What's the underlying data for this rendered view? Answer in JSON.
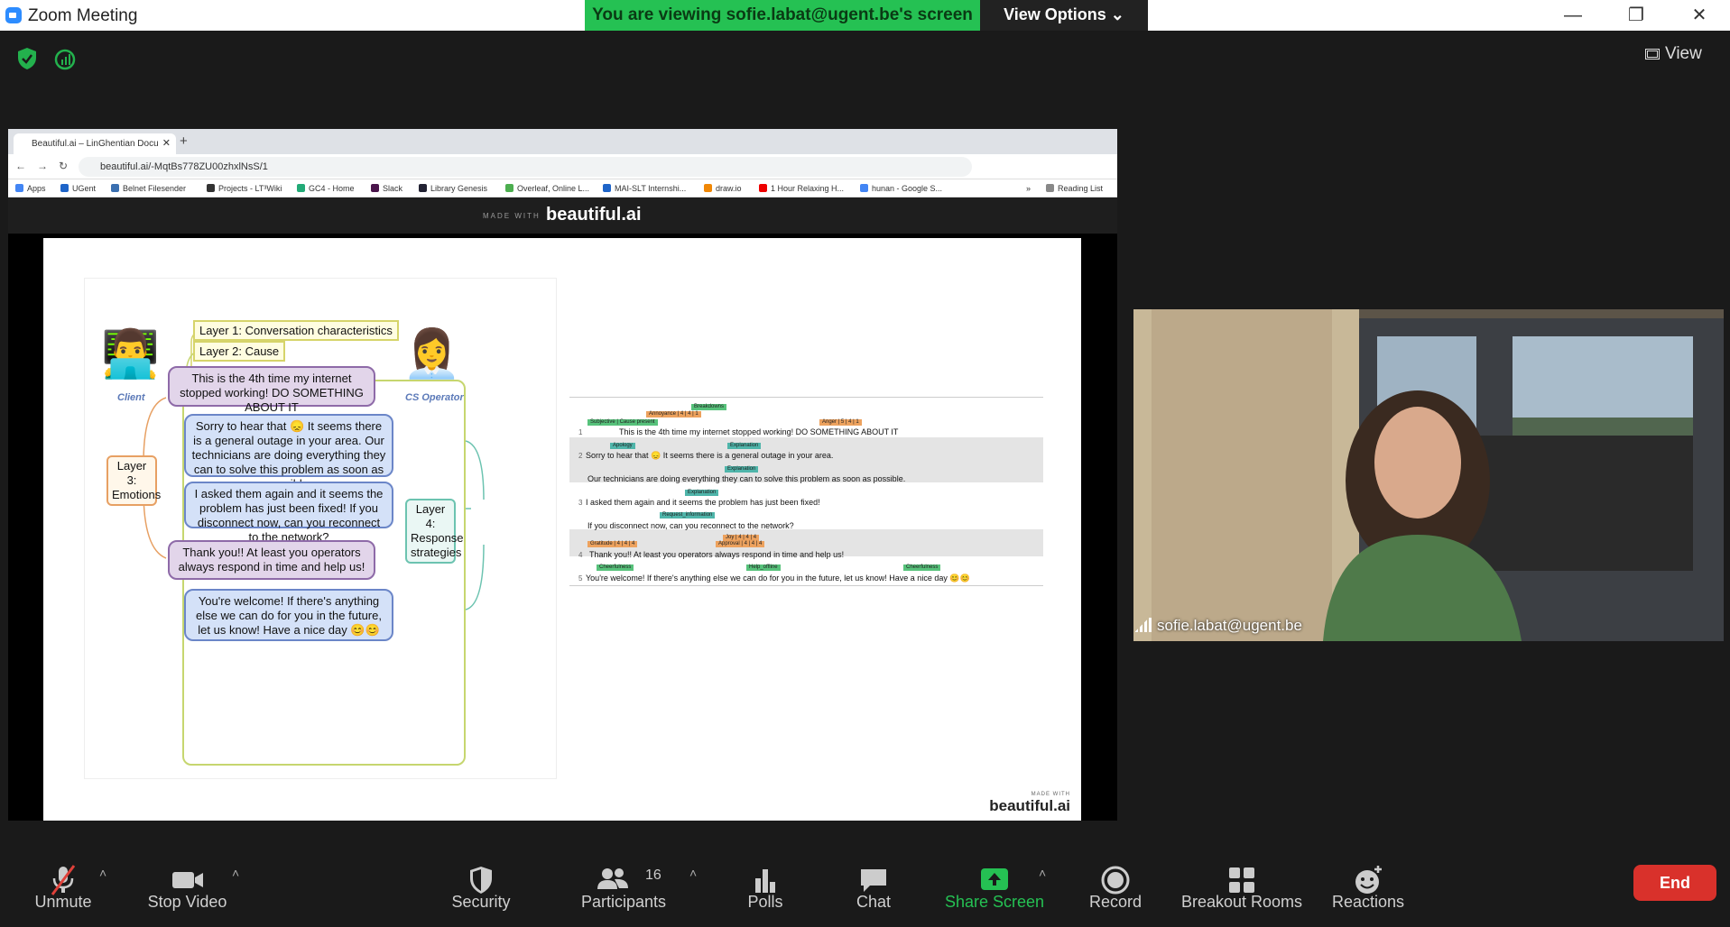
{
  "window": {
    "title": "Zoom Meeting",
    "viewing_banner": "You are viewing sofie.labat@ugent.be's screen",
    "view_options": "View Options",
    "minimize": "—",
    "restore": "❐",
    "close": "✕",
    "view_label": "View"
  },
  "browser": {
    "tab_title": "Beautiful.ai – LinGhentian Docu",
    "tab_close": "✕",
    "new_tab": "+",
    "url": "beautiful.ai/-MqtBs778ZU00zhxlNsS/1",
    "bookmarks": [
      "Apps",
      "UGent",
      "Belnet Filesender",
      "Projects - LT³Wiki",
      "GC4 - Home",
      "Slack",
      "Library Genesis",
      "Overleaf, Online L...",
      "MAI-SLT Internshi...",
      "draw.io",
      "1 Hour Relaxing H...",
      "hunan - Google S...",
      "»",
      "Reading List"
    ]
  },
  "banner": {
    "small": "MADE WITH",
    "brand": "beautiful.ai"
  },
  "figure": {
    "layer1": "Layer 1: Conversation characteristics",
    "layer2": "Layer 2: Cause",
    "layer3": [
      "Layer 3:",
      "Emotions"
    ],
    "layer4": [
      "Layer 4:",
      "Response",
      "strategies"
    ],
    "client_caption": "Client",
    "operator_caption": "CS Operator",
    "bubbles": [
      "This is the 4th time my internet stopped working! DO SOMETHING ABOUT IT",
      "Sorry to hear that 😞 It seems there is a general outage in your area. Our technicians are doing everything they can to solve this problem as soon as possible.",
      "I asked them again and it seems the problem has just been fixed! If you disconnect now, can you reconnect to the network?",
      "Thank you!! At least you operators always respond in time and help us!",
      "You're welcome! If there's anything else we can do for you in the future, let us know! Have a nice day 😊😊"
    ]
  },
  "annotation": {
    "tags": [
      "Breakdowns",
      "Annoyance | 4 | 4 | 1",
      "Subjective | Cause present",
      "Anger | 5 | 4 | 1",
      "Apology",
      "Explanation",
      "Explanation",
      "Explanation",
      "Request_information",
      "Joy | 4 | 4 | 4",
      "Gratitude | 4 | 4 | 4",
      "Approval | 4 | 4 | 4",
      "Cheerfulness",
      "Help_offline",
      "Cheerfulness"
    ],
    "lines": [
      {
        "n": "1",
        "text": "This is the 4th time my internet stopped working! DO SOMETHING ABOUT IT"
      },
      {
        "n": "2",
        "text": "Sorry to hear that 😞 It seems there is a general outage in your area."
      },
      {
        "n": "",
        "text": "Our technicians are doing everything they can to solve this problem as soon as possible."
      },
      {
        "n": "3",
        "text": "I asked them again and it seems the problem has just been fixed!"
      },
      {
        "n": "",
        "text": "If you disconnect now, can you reconnect to the network?"
      },
      {
        "n": "4",
        "text": "Thank you!!  At least you operators always respond in time and help us!"
      },
      {
        "n": "5",
        "text": "You're welcome! If there's anything else we can do for you in the future, let us know! Have a nice day 😊😊"
      }
    ]
  },
  "slide_brand": {
    "small": "MADE WITH",
    "brand": "beautiful.ai"
  },
  "participant": {
    "name": "sofie.labat@ugent.be"
  },
  "toolbar": {
    "unmute": "Unmute",
    "stop_video": "Stop Video",
    "security": "Security",
    "participants": "Participants",
    "participants_count": "16",
    "polls": "Polls",
    "chat": "Chat",
    "share_screen": "Share Screen",
    "record": "Record",
    "breakout": "Breakout Rooms",
    "reactions": "Reactions",
    "end": "End",
    "caret": "˄"
  },
  "colors": {
    "share_green": "#25c153",
    "end_red": "#d9312b",
    "zoom_blue": "#2d8cff"
  }
}
